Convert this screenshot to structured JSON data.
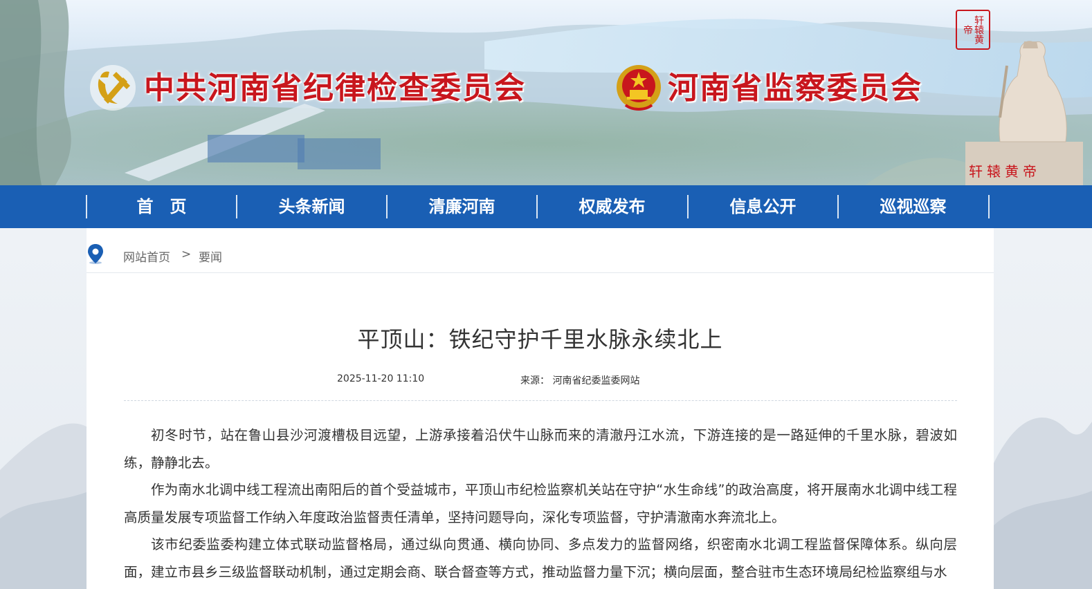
{
  "banner": {
    "title_left": "中共河南省纪律检查委员会",
    "title_right": "河南省监察委员会",
    "seal_text": "轩辕黄帝",
    "statue_label": "轩辕黄帝",
    "title_color": "#c8161d"
  },
  "nav": {
    "color": "#1a5fb4",
    "items": [
      {
        "label": "首　页"
      },
      {
        "label": "头条新闻"
      },
      {
        "label": "清廉河南"
      },
      {
        "label": "权威发布"
      },
      {
        "label": "信息公开"
      },
      {
        "label": "巡视巡察"
      }
    ]
  },
  "breadcrumb": {
    "icon": "location-pin-icon",
    "home": "网站首页",
    "separator": ">",
    "current": "要闻"
  },
  "article": {
    "title": "平顶山：铁纪守护千里水脉永续北上",
    "date": "2025-11-20 11:10",
    "source": "来源： 河南省纪委监委网站",
    "paragraphs": [
      "初冬时节，站在鲁山县沙河渡槽极目远望，上游承接着沿伏牛山脉而来的清澈丹江水流，下游连接的是一路延伸的千里水脉，碧波如练，静静北去。",
      "作为南水北调中线工程流出南阳后的首个受益城市，平顶山市纪检监察机关站在守护“水生命线”的政治高度，将开展南水北调中线工程高质量发展专项监督工作纳入年度政治监督责任清单，坚持问题导向，深化专项监督，守护清澈南水奔流北上。",
      "该市纪委监委构建立体式联动监督格局，通过纵向贯通、横向协同、多点发力的监督网络，织密南水北调工程监督保障体系。纵向层面，建立市县乡三级监督联动机制，通过定期会商、联合督查等方式，推动监督力量下沉；横向层面，整合驻市生态环境局纪检监察组与水"
    ]
  }
}
